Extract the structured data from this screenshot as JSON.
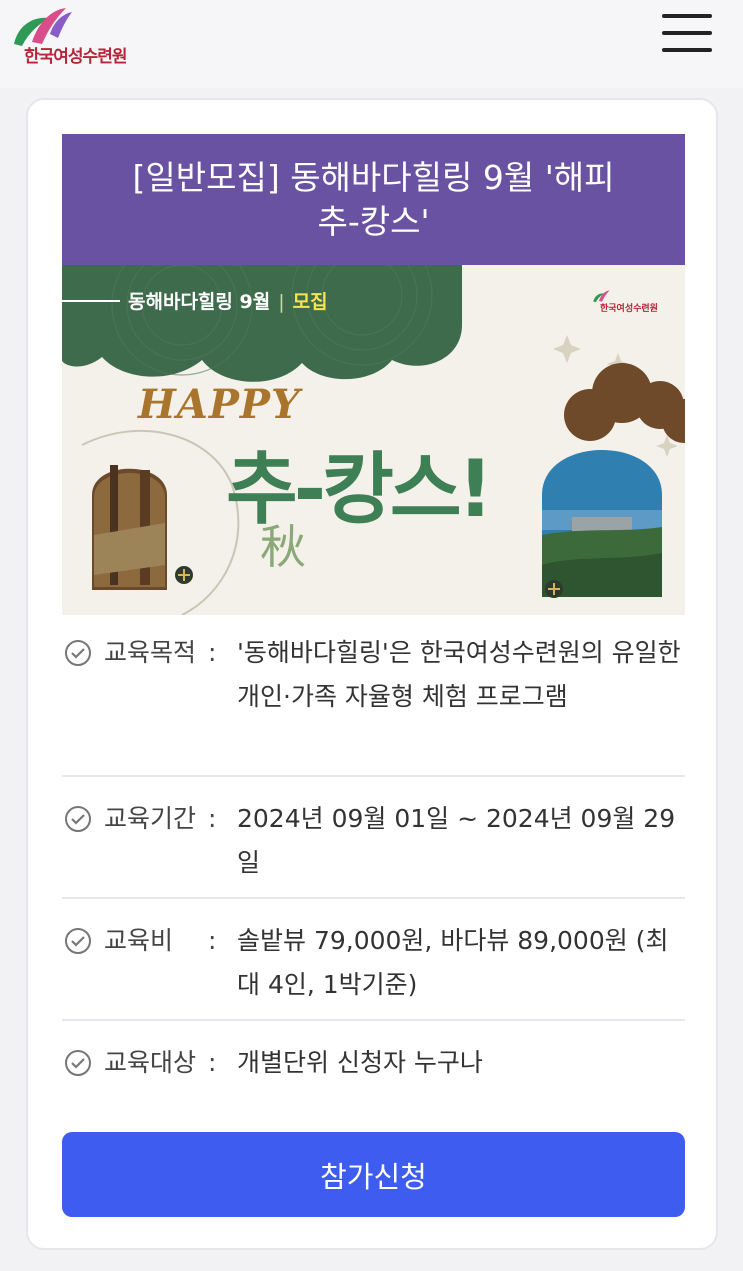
{
  "header": {
    "logo_text": "한국여성수련원",
    "menu_icon": "hamburger-menu-icon"
  },
  "program": {
    "title": "[일반모집] 동해바다힐링 9월 '해피 추-캉스'",
    "banner": {
      "head_left": "동해바다힐링 9월",
      "head_right": "모집",
      "logo_text": "한국여성수련원",
      "happy": "HAPPY",
      "headline": "추-캉스!",
      "hanja": "秋"
    },
    "info": [
      {
        "label": "교육목적",
        "value": "'동해바다힐링'은 한국여성수련원의 유일한 개인·가족 자율형 체험 프로그램"
      },
      {
        "label": "교육기간",
        "value": "2024년 09월 01일 ~ 2024년 09월 29일"
      },
      {
        "label": "교육비",
        "value": "솔밭뷰 79,000원, 바다뷰 89,000원 (최대 4인, 1박기준)"
      },
      {
        "label": "교육대상",
        "value": "개별단위 신청자 누구나"
      }
    ],
    "apply_label": "참가신청"
  },
  "colors": {
    "title_bg": "#6a52a3",
    "button_bg": "#3f5cf0",
    "banner_green": "#3e6b4b",
    "logo_red": "#b5263a"
  }
}
